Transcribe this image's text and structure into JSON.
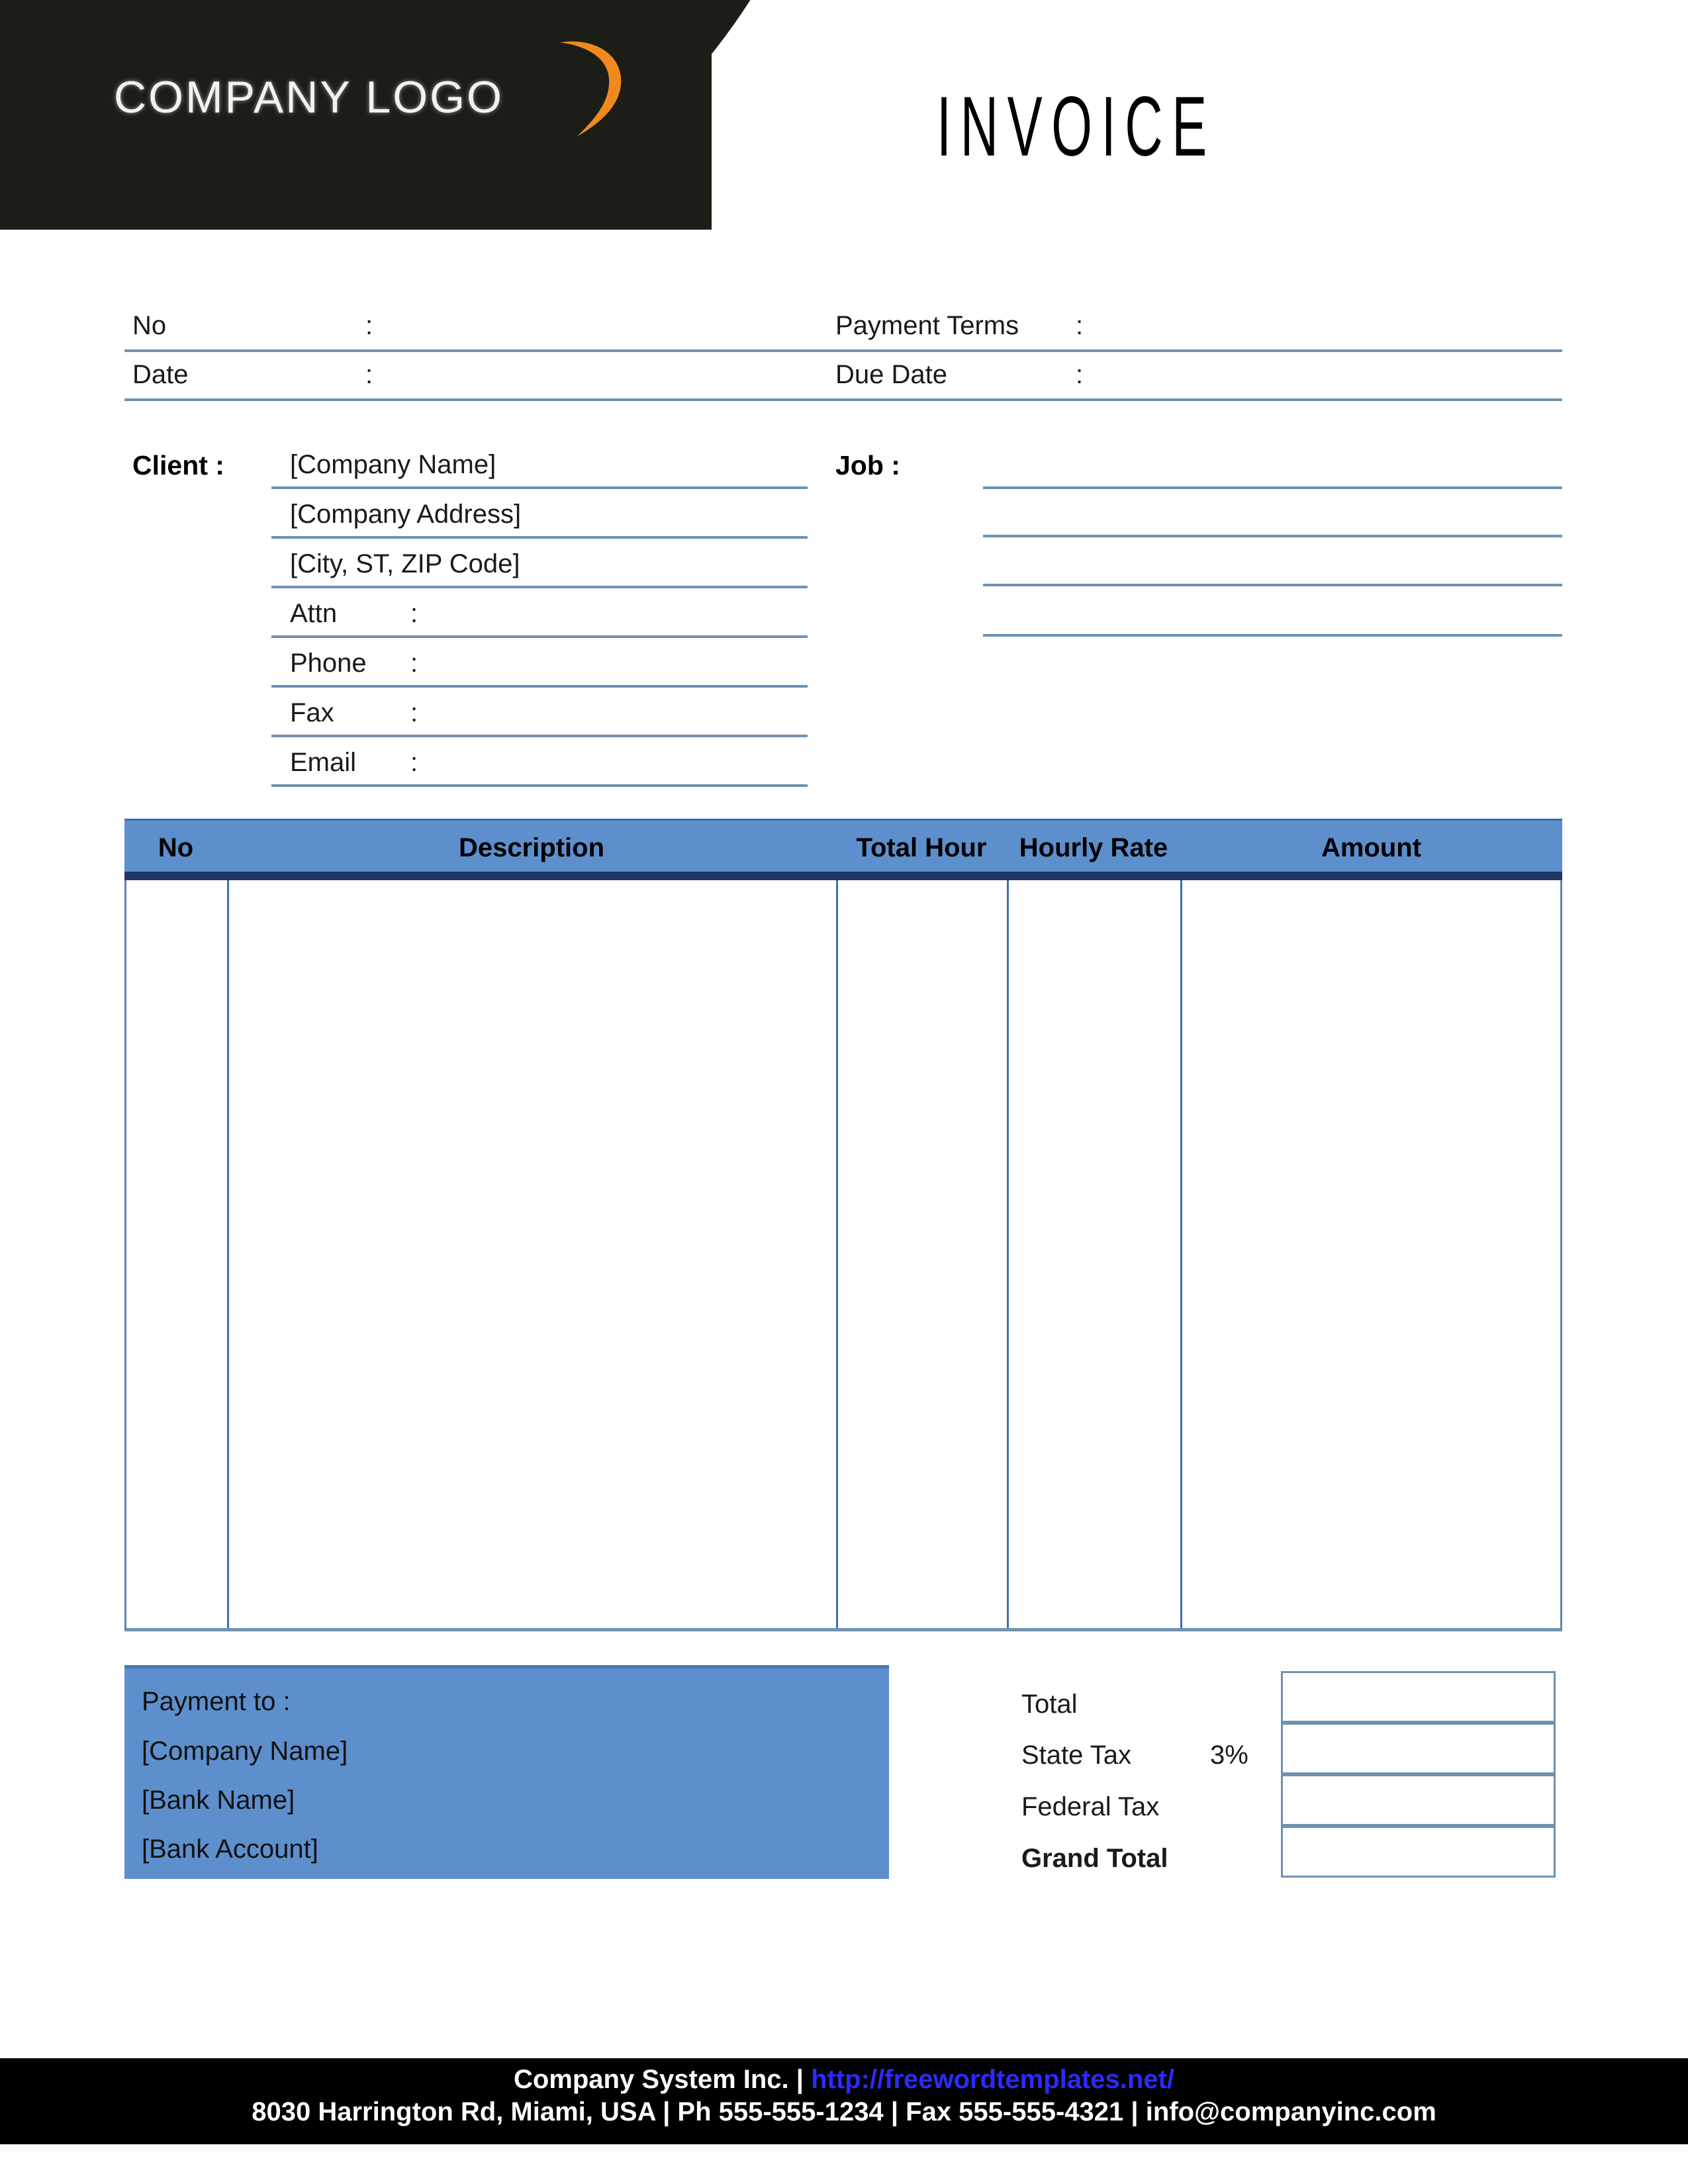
{
  "header": {
    "logo_text": "COMPANY LOGO",
    "logo_swoosh_icon": "swoosh-arc-icon",
    "title": "INVOICE",
    "background_color": "#1c1d17",
    "swoosh_color": "#f08a1e"
  },
  "meta": {
    "rows": [
      {
        "label": "No",
        "colon": ":",
        "value": "",
        "label2": "Payment  Terms",
        "colon2": ":",
        "value2": ""
      },
      {
        "label": "Date",
        "colon": ":",
        "value": "",
        "label2": "Due Date",
        "colon2": ":",
        "value2": ""
      }
    ]
  },
  "client": {
    "label": "Client  :",
    "lines": [
      {
        "text": "[Company Name]",
        "colon": "",
        "value": ""
      },
      {
        "text": "[Company Address]",
        "colon": "",
        "value": ""
      },
      {
        "text": "[City, ST, ZIP Code]",
        "colon": "",
        "value": ""
      },
      {
        "text": "Attn",
        "colon": ":",
        "value": ""
      },
      {
        "text": "Phone",
        "colon": ":",
        "value": ""
      },
      {
        "text": "Fax",
        "colon": ":",
        "value": ""
      },
      {
        "text": "Email",
        "colon": ":",
        "value": ""
      }
    ]
  },
  "job": {
    "label": "Job  :",
    "lines": [
      "",
      "",
      "",
      ""
    ]
  },
  "items": {
    "headers": [
      "No",
      "Description",
      "Total Hour",
      "Hourly Rate",
      "Amount"
    ],
    "rows": [],
    "header_bg": "#5d8fcd",
    "header_text_color": "#000000"
  },
  "payment_to": {
    "title": "Payment to :",
    "lines": [
      "[Company Name]",
      "[Bank Name]",
      "[Bank Account]"
    ],
    "background_color": "#5d8fcd"
  },
  "totals": {
    "rows": [
      {
        "label": "Total",
        "pct": "",
        "value": "",
        "bold": false
      },
      {
        "label": "State Tax",
        "pct": "3%",
        "value": "",
        "bold": false
      },
      {
        "label": "Federal Tax",
        "pct": "",
        "value": "",
        "bold": false
      },
      {
        "label": "Grand Total",
        "pct": "",
        "value": "",
        "bold": true
      }
    ]
  },
  "footer": {
    "company": "Company System Inc. | ",
    "url": "http://freewordtemplates.net/",
    "address": "8030 Harrington Rd, Miami, USA | Ph 555-555-1234 | Fax 555-555-4321 | info@companyinc.com",
    "background_color": "#000000",
    "url_color": "#2b2bff"
  }
}
